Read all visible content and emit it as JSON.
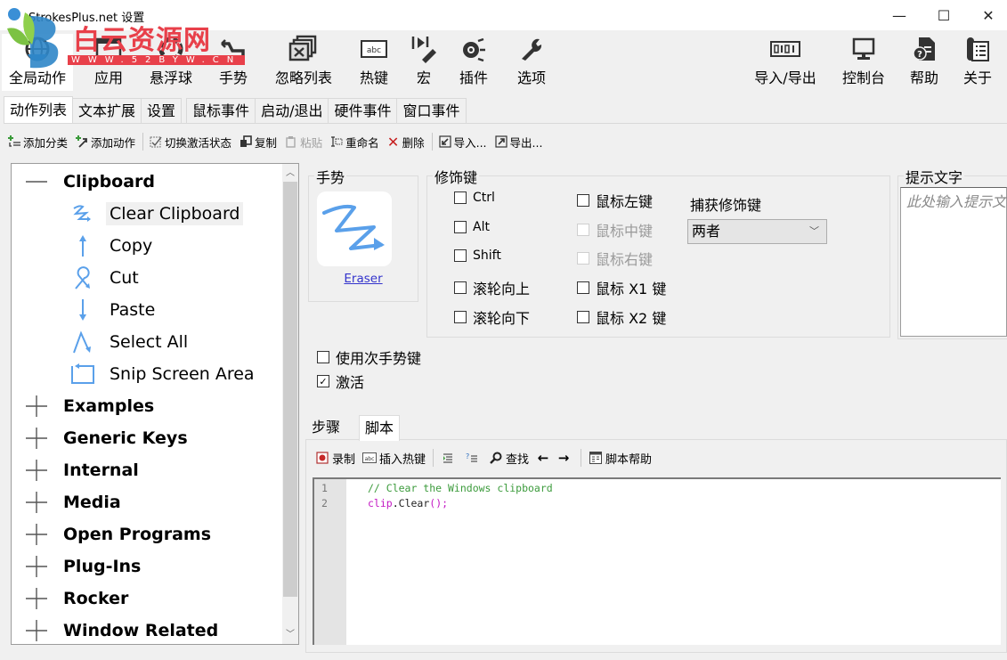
{
  "window": {
    "title": "StrokesPlus.net 设置",
    "controls": {
      "minimize": "—",
      "maximize": "☐",
      "close": "✕"
    }
  },
  "watermark": {
    "text": "白云资源网",
    "url": "WWW.52BYW.CN"
  },
  "ribbon": {
    "left": [
      {
        "label": "全局动作",
        "icon": "globe-icon",
        "active": true
      },
      {
        "label": "应用",
        "icon": "window-icon"
      },
      {
        "label": "悬浮球",
        "icon": "dotted-circle-icon"
      },
      {
        "label": "手势",
        "icon": "gesture-icon"
      },
      {
        "label": "忽略列表",
        "icon": "ignore-list-icon"
      },
      {
        "label": "热键",
        "icon": "keyboard-abc-icon"
      },
      {
        "label": "宏",
        "icon": "macro-icon"
      },
      {
        "label": "插件",
        "icon": "plugin-icon"
      },
      {
        "label": "选项",
        "icon": "wrench-icon"
      }
    ],
    "right": [
      {
        "label": "导入/导出",
        "icon": "binary-icon"
      },
      {
        "label": "控制台",
        "icon": "monitor-icon"
      },
      {
        "label": "帮助",
        "icon": "help-document-icon"
      },
      {
        "label": "关于",
        "icon": "about-scroll-icon"
      }
    ]
  },
  "tabs": [
    {
      "label": "动作列表",
      "active": true
    },
    {
      "label": "文本扩展"
    },
    {
      "label": "设置"
    },
    {
      "label": "鼠标事件"
    },
    {
      "label": "启动/退出"
    },
    {
      "label": "硬件事件"
    },
    {
      "label": "窗口事件"
    }
  ],
  "action_toolbar": {
    "add_category": "添加分类",
    "add_action": "添加动作",
    "toggle_active": "切换激活状态",
    "copy": "复制",
    "paste": "粘贴",
    "rename": "重命名",
    "delete": "删除",
    "import": "导入...",
    "export": "导出..."
  },
  "tree": {
    "categories": [
      {
        "name": "Clipboard",
        "expanded": true,
        "actions": [
          {
            "name": "Clear Clipboard",
            "selected": true,
            "gesture": "z-zigzag"
          },
          {
            "name": "Copy",
            "gesture": "up"
          },
          {
            "name": "Cut",
            "gesture": "loop"
          },
          {
            "name": "Paste",
            "gesture": "down"
          },
          {
            "name": "Select All",
            "gesture": "caret"
          },
          {
            "name": "Snip Screen Area",
            "gesture": "rectangle"
          }
        ]
      },
      {
        "name": "Examples",
        "expanded": false
      },
      {
        "name": "Generic Keys",
        "expanded": false
      },
      {
        "name": "Internal",
        "expanded": false
      },
      {
        "name": "Media",
        "expanded": false
      },
      {
        "name": "Open Programs",
        "expanded": false
      },
      {
        "name": "Plug-Ins",
        "expanded": false
      },
      {
        "name": "Rocker",
        "expanded": false
      },
      {
        "name": "Window Related",
        "expanded": false
      }
    ]
  },
  "gesture": {
    "legend": "手势",
    "name": "Eraser"
  },
  "modifiers": {
    "legend": "修饰键",
    "left": [
      {
        "label": "Ctrl",
        "checked": false
      },
      {
        "label": "Alt",
        "checked": false
      },
      {
        "label": "Shift",
        "checked": false
      },
      {
        "label": "滚轮向上",
        "checked": false
      },
      {
        "label": "滚轮向下",
        "checked": false
      }
    ],
    "right": [
      {
        "label": "鼠标左键",
        "checked": false,
        "enabled": true
      },
      {
        "label": "鼠标中键",
        "checked": false,
        "enabled": false
      },
      {
        "label": "鼠标右键",
        "checked": false,
        "enabled": false
      },
      {
        "label": "鼠标 X1 键",
        "checked": false,
        "enabled": true
      },
      {
        "label": "鼠标 X2 键",
        "checked": false,
        "enabled": true
      }
    ],
    "capture_label": "捕获修饰键",
    "capture_value": "两者"
  },
  "hint": {
    "legend": "提示文字",
    "placeholder": "此处输入提示文字"
  },
  "options": {
    "secondary_key": {
      "label": "使用次手势键",
      "checked": false
    },
    "active": {
      "label": "激活",
      "checked": true
    }
  },
  "subtabs": [
    {
      "label": "步骤"
    },
    {
      "label": "脚本",
      "active": true
    }
  ],
  "script_toolbar": {
    "record": "录制",
    "insert_hotkey": "插入热键",
    "find": "查找",
    "script_help": "脚本帮助"
  },
  "editor": {
    "lines": [
      {
        "num": "1",
        "comment": "// Clear the Windows clipboard"
      },
      {
        "num": "2",
        "obj": "clip",
        "dot": ".",
        "fn": "Clear",
        "rest": "();"
      }
    ]
  },
  "colors": {
    "gesture_blue": "#5aa0ea",
    "code_comment": "#3c9b3c",
    "code_object": "#c318c3",
    "link": "#3333cc"
  }
}
